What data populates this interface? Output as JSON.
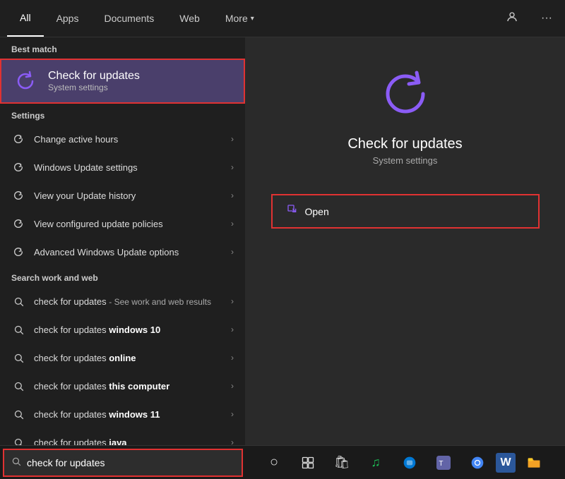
{
  "nav": {
    "tabs": [
      {
        "label": "All",
        "active": true
      },
      {
        "label": "Apps",
        "active": false
      },
      {
        "label": "Documents",
        "active": false
      },
      {
        "label": "Web",
        "active": false
      },
      {
        "label": "More",
        "active": false,
        "hasChevron": true
      }
    ],
    "right_icons": [
      "person-icon",
      "more-icon"
    ]
  },
  "best_match": {
    "section_label": "Best match",
    "item": {
      "title": "Check for updates",
      "subtitle": "System settings"
    }
  },
  "settings": {
    "section_label": "Settings",
    "items": [
      {
        "text": "Change active hours"
      },
      {
        "text": "Windows Update settings"
      },
      {
        "text": "View your Update history"
      },
      {
        "text": "View configured update policies"
      },
      {
        "text": "Advanced Windows Update options"
      }
    ]
  },
  "search_web": {
    "section_label": "Search work and web",
    "items": [
      {
        "text": "check for updates",
        "suffix": " - See work and web results",
        "suffix_bold": false
      },
      {
        "text": "check for updates ",
        "bold_part": "windows 10"
      },
      {
        "text": "check for updates ",
        "bold_part": "online"
      },
      {
        "text": "check for updates ",
        "bold_part": "this computer"
      },
      {
        "text": "check for updates ",
        "bold_part": "windows 11"
      },
      {
        "text": "check for updates ",
        "bold_part": "java"
      }
    ]
  },
  "detail": {
    "title": "Check for updates",
    "subtitle": "System settings",
    "open_label": "Open"
  },
  "taskbar": {
    "search_placeholder": "check for updates",
    "icons": [
      {
        "name": "cortana-icon",
        "symbol": "○"
      },
      {
        "name": "task-view-icon",
        "symbol": "⧉"
      },
      {
        "name": "store-icon",
        "symbol": "🛍"
      },
      {
        "name": "spotify-icon",
        "symbol": "♫"
      },
      {
        "name": "edge-icon",
        "symbol": "🌐"
      },
      {
        "name": "teams-icon",
        "symbol": "👥"
      },
      {
        "name": "chrome-icon",
        "symbol": "⊕"
      },
      {
        "name": "word-icon",
        "symbol": "W"
      },
      {
        "name": "explorer-icon",
        "symbol": "📁"
      }
    ]
  },
  "colors": {
    "accent_purple": "#8b5cf6",
    "highlight_bg": "#4a3f6b",
    "red_border": "#e03232"
  }
}
